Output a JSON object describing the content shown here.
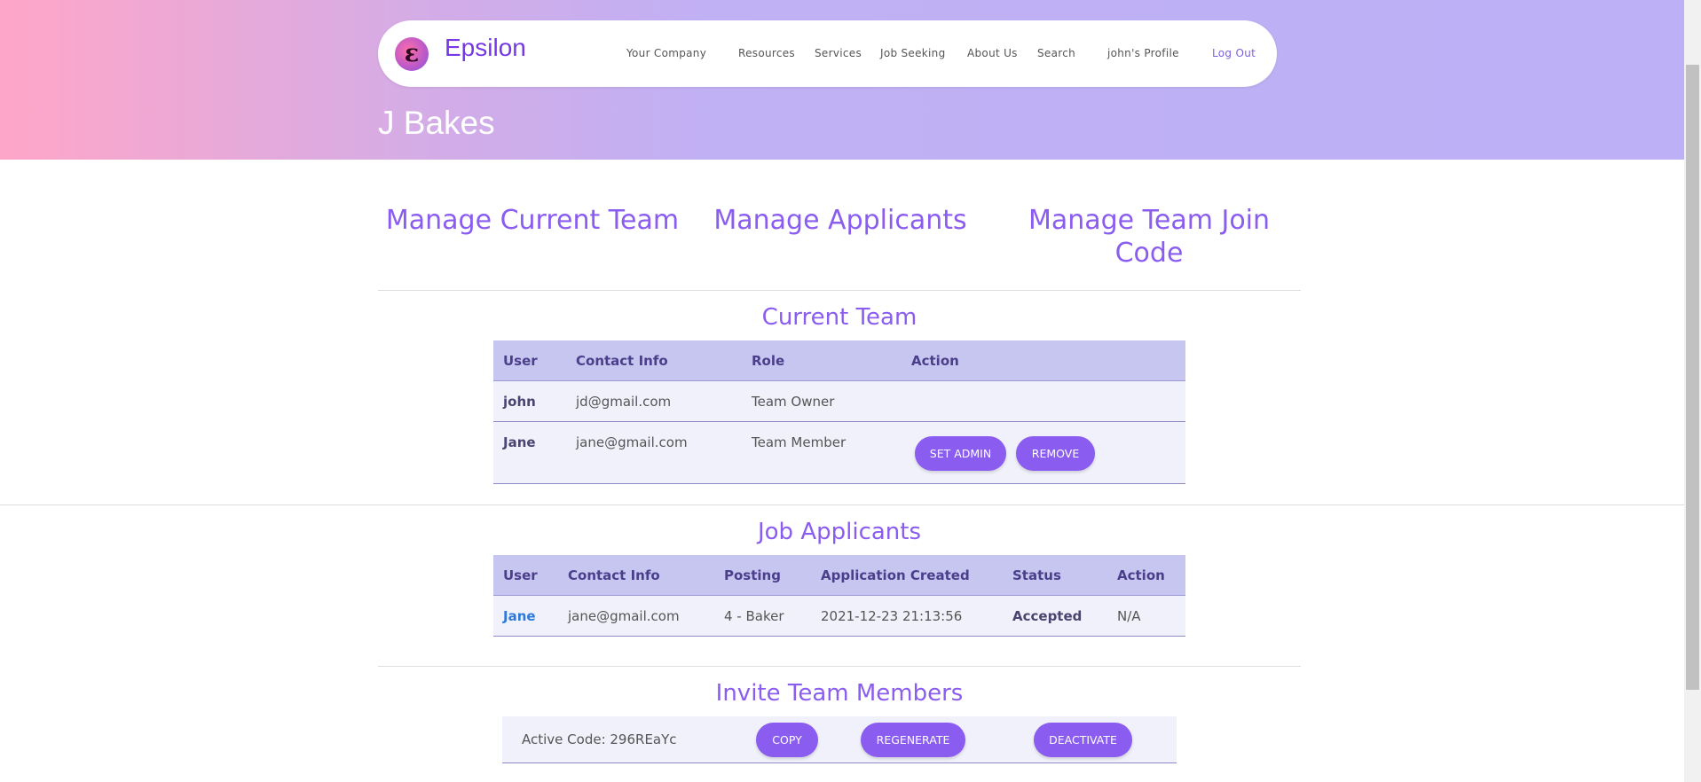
{
  "brand": {
    "name": "Epsilon",
    "logo_glyph": "ε"
  },
  "nav": {
    "items": [
      "Your Company",
      "Resources",
      "Services",
      "Job Seeking",
      "About Us",
      "Search",
      "john's Profile"
    ],
    "logout": "Log Out"
  },
  "company_name": "J Bakes",
  "sections": {
    "manage_team": "Manage Current Team",
    "manage_applicants": "Manage Applicants",
    "manage_code_line1": "Manage Team Join",
    "manage_code_line2": "Code"
  },
  "current_team": {
    "title": "Current Team",
    "headers": [
      "User",
      "Contact Info",
      "Role",
      "Action"
    ],
    "rows": [
      {
        "user": "john",
        "contact": "jd@gmail.com",
        "role": "Team Owner"
      },
      {
        "user": "Jane",
        "contact": "jane@gmail.com",
        "role": "Team Member",
        "actions": [
          "SET ADMIN",
          "REMOVE"
        ]
      }
    ]
  },
  "job_applicants": {
    "title": "Job Applicants",
    "headers": [
      "User",
      "Contact Info",
      "Posting",
      "Application Created",
      "Status",
      "Action"
    ],
    "rows": [
      {
        "user": "Jane",
        "contact": "jane@gmail.com",
        "posting": "4 - Baker",
        "created": "2021-12-23 21:13:56",
        "status": "Accepted",
        "action": "N/A"
      }
    ]
  },
  "invite": {
    "title": "Invite Team Members",
    "active_code": "Active Code: 296REaYc",
    "buttons": [
      "COPY",
      "REGENERATE",
      "DEACTIVATE"
    ]
  },
  "colors": {
    "accent": "#8a5cf0",
    "brand": "#7638e4",
    "table_header": "#c6c6f0",
    "table_row": "#f1f1fb",
    "link": "#2f7ad8"
  }
}
